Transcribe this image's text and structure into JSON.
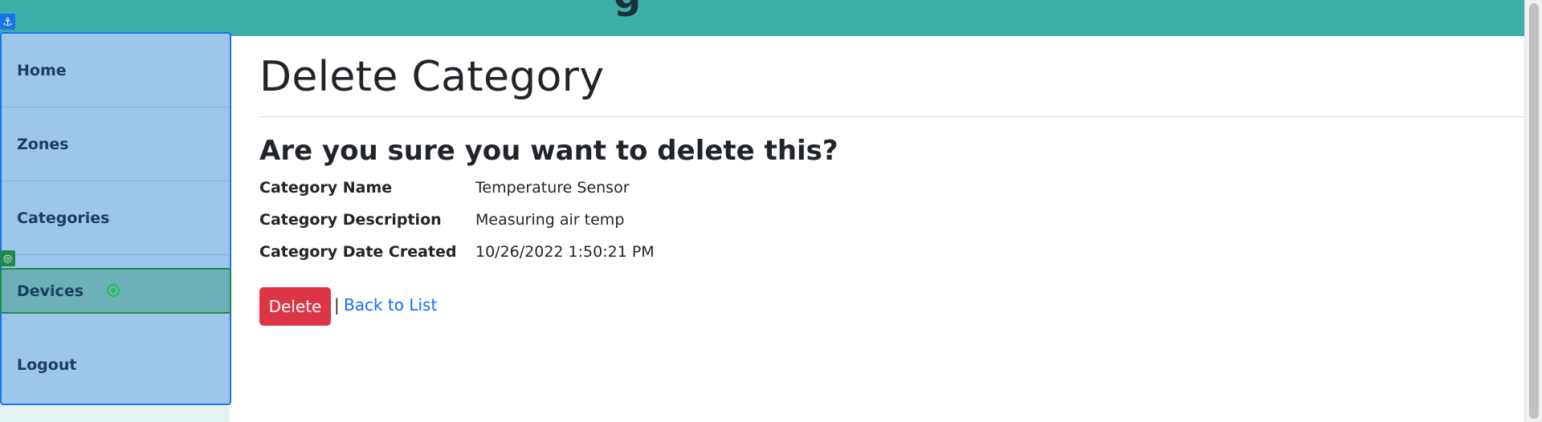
{
  "topbar": {
    "title_fragment": "g",
    "color": "#3bb0a8"
  },
  "sidebar": {
    "items": [
      {
        "label": "Home"
      },
      {
        "label": "Zones"
      },
      {
        "label": "Categories"
      },
      {
        "label": "Devices",
        "active": true
      },
      {
        "label": "Logout"
      }
    ],
    "background": "#9dc7ea",
    "active_background": "#6bb0b8"
  },
  "overlays": {
    "anchor_icon": "⚓",
    "target_icon": "◎"
  },
  "main": {
    "title": "Delete Category",
    "confirm_question": "Are you sure you want to delete this?",
    "details": [
      {
        "label": "Category Name",
        "value": "Temperature Sensor"
      },
      {
        "label": "Category Description",
        "value": "Measuring air temp"
      },
      {
        "label": "Category Date Created",
        "value": "10/26/2022 1:50:21 PM"
      }
    ],
    "delete_label": "Delete",
    "separator": "|",
    "back_link_label": "Back to List",
    "delete_color": "#dc3545",
    "link_color": "#0d6efd"
  }
}
